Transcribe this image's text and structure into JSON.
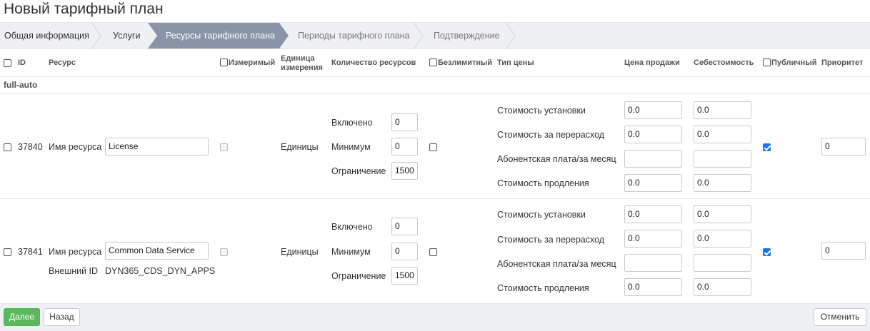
{
  "page": {
    "title": "Новый тарифный план"
  },
  "steps": [
    {
      "label": "Общая информация"
    },
    {
      "label": "Услуги"
    },
    {
      "label": "Ресурсы тарифного плана"
    },
    {
      "label": "Периоды тарифного плана"
    },
    {
      "label": "Подтверждение"
    }
  ],
  "columns": {
    "id": "ID",
    "resource": "Ресурс",
    "measurable": "Измеримый",
    "unit_line1": "Единица",
    "unit_line2": "измерения",
    "quantity": "Количество ресурсов",
    "unlimited": "Безлимитный",
    "price_type": "Тип цены",
    "sale_price": "Цена продажи",
    "cost": "Себестоимость",
    "public": "Публичный",
    "priority": "Приоритет"
  },
  "group": {
    "name": "full-auto"
  },
  "rows": [
    {
      "id": "37840",
      "resource_label": "Имя ресурса",
      "resource_value": "License",
      "unit": "Единицы",
      "included_label": "Включено",
      "included": "0",
      "minimum_label": "Минимум",
      "minimum": "0",
      "limit_label": "Ограничение",
      "limit": "1500",
      "prices": [
        {
          "label": "Стоимость установки",
          "sale": "0.0",
          "cost": "0.0"
        },
        {
          "label": "Стоимость за перерасход",
          "sale": "0.0",
          "cost": "0.0"
        },
        {
          "label": "Абонентская плата/за месяц",
          "sale": "",
          "cost": ""
        },
        {
          "label": "Стоимость продления",
          "sale": "0.0",
          "cost": "0.0"
        }
      ],
      "priority": "0"
    },
    {
      "id": "37841",
      "resource_label": "Имя ресурса",
      "resource_value": "Common Data Service",
      "external_label": "Внешний ID",
      "external_value": "DYN365_CDS_DYN_APPS",
      "unit": "Единицы",
      "included_label": "Включено",
      "included": "0",
      "minimum_label": "Минимум",
      "minimum": "0",
      "limit_label": "Ограничение",
      "limit": "1500",
      "prices": [
        {
          "label": "Стоимость установки",
          "sale": "0.0",
          "cost": "0.0"
        },
        {
          "label": "Стоимость за перерасход",
          "sale": "0.0",
          "cost": "0.0"
        },
        {
          "label": "Абонентская плата/за месяц",
          "sale": "",
          "cost": ""
        },
        {
          "label": "Стоимость продления",
          "sale": "0.0",
          "cost": "0.0"
        }
      ],
      "priority": "0"
    }
  ],
  "footer": {
    "next": "Далее",
    "back": "Назад",
    "cancel": "Отменить"
  },
  "colors": {
    "active_step": "#8a94a8",
    "primary": "#5cb85c",
    "checkbox_on": "#1a73e8"
  }
}
